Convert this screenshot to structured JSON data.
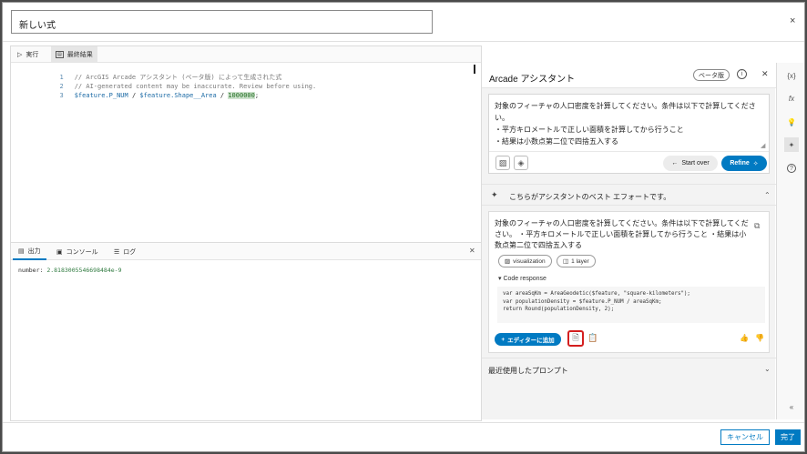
{
  "dialog": {
    "title_value": "新しい式",
    "close_glyph": "×"
  },
  "editor": {
    "toolbar": {
      "run_label": "実行",
      "result_label": "最終結果"
    },
    "lines": [
      {
        "num": "1",
        "comment": "// ArcGIS Arcade アシスタント (ベータ版) によって生成された式"
      },
      {
        "num": "2",
        "comment": "// AI-generated content may be inaccurate. Review before using."
      },
      {
        "num": "3",
        "code_a": "$feature.P_NUM",
        "op1": " / ",
        "code_b": "$feature.Shape__Area",
        "op2": " / ",
        "number": "1000000",
        "end": ";"
      }
    ]
  },
  "output": {
    "tabs": {
      "output": "出力",
      "console": "コンソール",
      "log": "ログ"
    },
    "result_key": "number: ",
    "result_value": "2.8183005546698484e-9"
  },
  "assistant": {
    "title": "Arcade アシスタント",
    "beta_badge": "ベータ版",
    "prompt_lines": [
      "対象のフィーチャの人口密度を計算してください。条件は以下で計算してください。",
      "・平方キロメートルで正しい面積を計算してから行うこと",
      "・結果は小数点第二位で四捨五入する"
    ],
    "start_over_label": "Start over",
    "refine_label": "Refine",
    "best_effort_label": "こちらがアシスタントのベスト エフォートです。",
    "response_text": "対象のフィーチャの人口密度を計算してください。条件は以下で計算してください。 ・平方キロメートルで正しい面積を計算してから行うこと ・結果は小数点第二位で四捨五入する",
    "chips": {
      "visualization": "visualization",
      "layer": "1 layer"
    },
    "code_response_label": "▾ Code response",
    "code_response": "var areaSqKm = AreaGeodetic($feature, \"square-kilometers\");\nvar populationDensity = $feature.P_NUM / areaSqKm;\nreturn Round(populationDensity, 2);",
    "add_to_editor_label": "エディターに追加",
    "recent_prompts_label": "最近使用したプロンプト"
  },
  "side_icons": [
    "{x}",
    "fx",
    "bulb",
    "sparkle",
    "?",
    "«"
  ],
  "footer": {
    "cancel_label": "キャンセル",
    "done_label": "完了"
  }
}
